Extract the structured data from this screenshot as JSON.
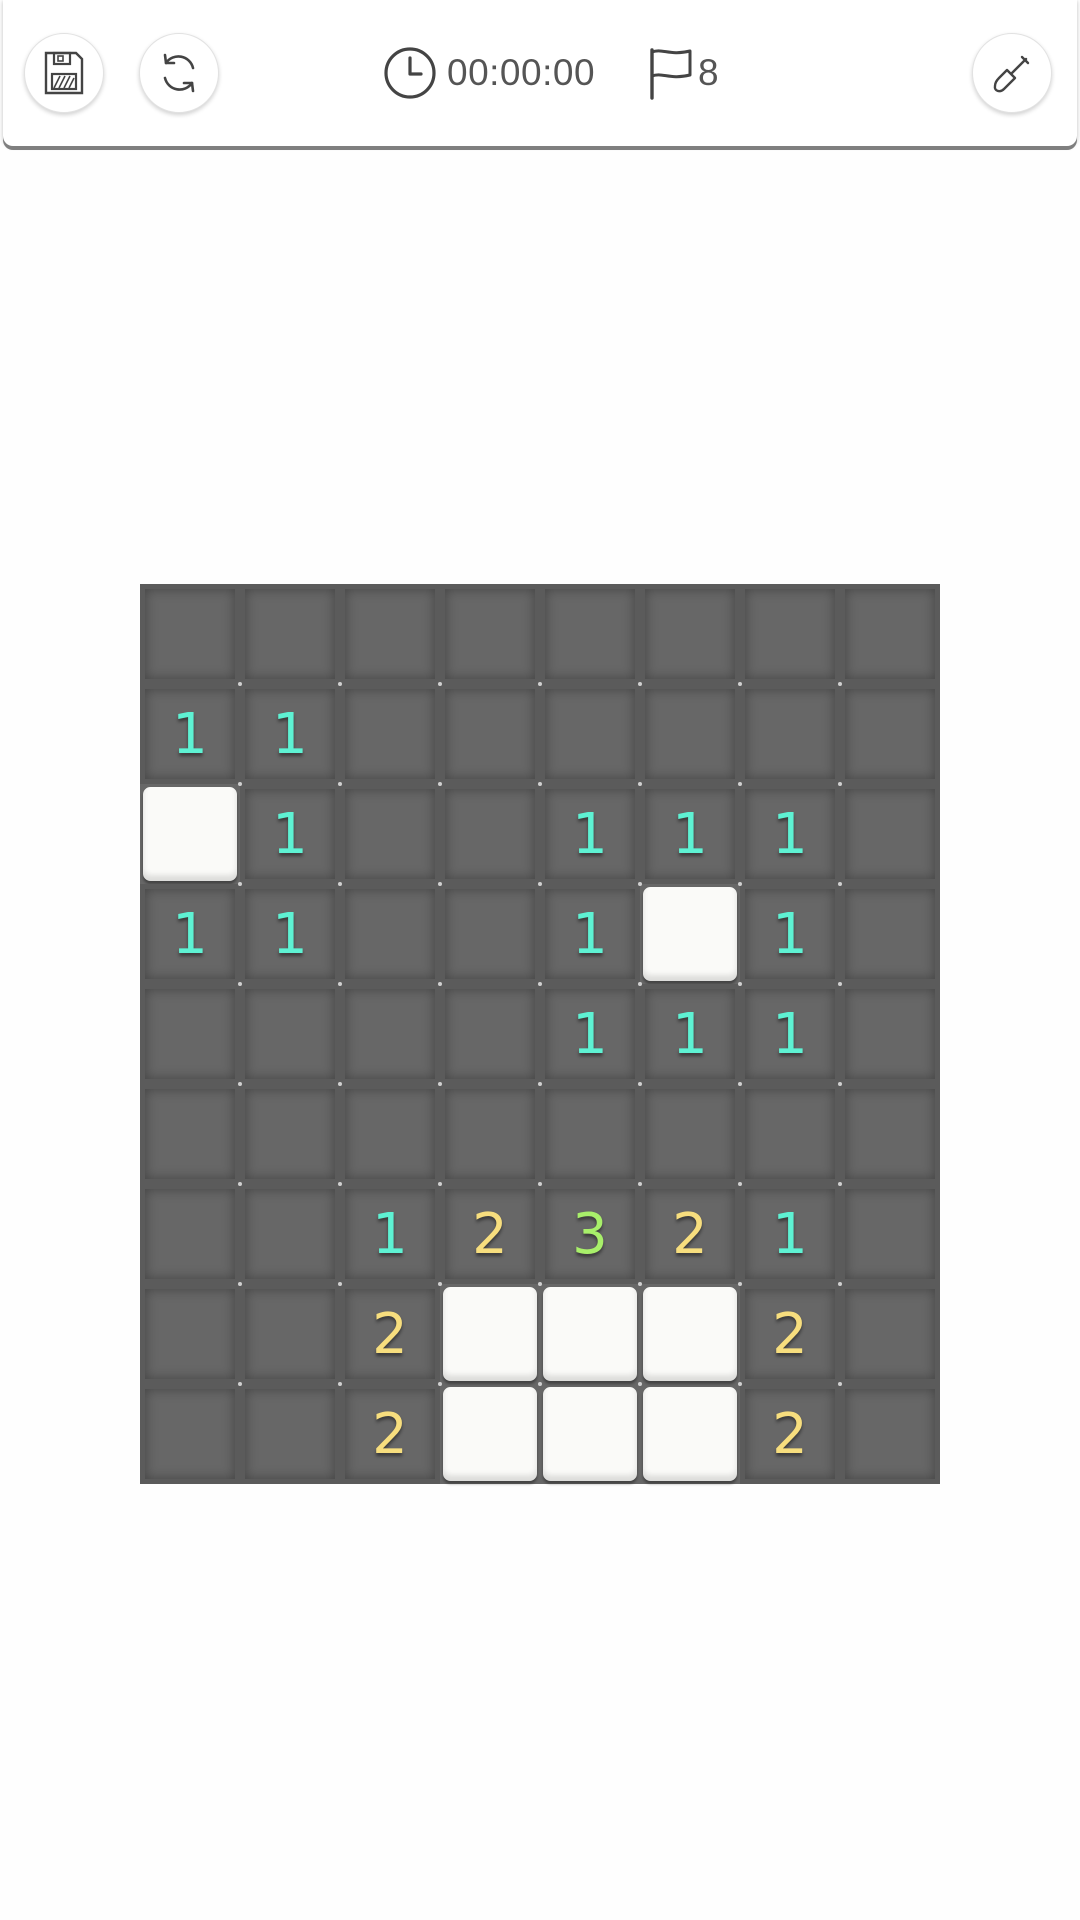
{
  "toolbar": {
    "save_icon": "floppy-disk-icon",
    "restart_icon": "refresh-icon",
    "timer_icon": "clock-icon",
    "timer": "00:00:00",
    "flag_icon": "flag-icon",
    "flags_remaining": "8",
    "mode_icon": "shovel-icon"
  },
  "colors": {
    "one": "#5ef2d3",
    "two": "#f7de7e",
    "three": "#a8ef6a",
    "hidden_tile": "#676767",
    "revealed_tile": "#fafaf8"
  },
  "board": {
    "columns": 8,
    "rows": 9,
    "cells": [
      [
        "H",
        "H",
        "H",
        "H",
        "H",
        "H",
        "H",
        "H"
      ],
      [
        "1",
        "1",
        "H",
        "H",
        "H",
        "H",
        "H",
        "H"
      ],
      [
        "R",
        "1",
        "H",
        "H",
        "1",
        "1",
        "1",
        "H"
      ],
      [
        "1",
        "1",
        "H",
        "H",
        "1",
        "R",
        "1",
        "H"
      ],
      [
        "H",
        "H",
        "H",
        "H",
        "1",
        "1",
        "1",
        "H"
      ],
      [
        "H",
        "H",
        "H",
        "H",
        "H",
        "H",
        "H",
        "H"
      ],
      [
        "H",
        "H",
        "1",
        "2",
        "3",
        "2",
        "1",
        "H"
      ],
      [
        "H",
        "H",
        "2",
        "R",
        "R",
        "R",
        "2",
        "H"
      ],
      [
        "H",
        "H",
        "2",
        "R",
        "R",
        "R",
        "2",
        "H"
      ]
    ]
  }
}
